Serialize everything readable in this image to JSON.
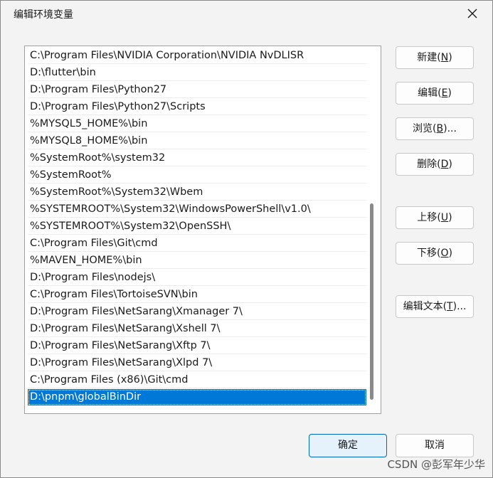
{
  "dialog": {
    "title": "编辑环境变量"
  },
  "paths": [
    "C:\\Program Files\\NVIDIA Corporation\\NVIDIA NvDLISR",
    "D:\\flutter\\bin",
    "D:\\Program Files\\Python27",
    "D:\\Program Files\\Python27\\Scripts",
    "%MYSQL5_HOME%\\bin",
    "%MYSQL8_HOME%\\bin",
    "%SystemRoot%\\system32",
    "%SystemRoot%",
    "%SystemRoot%\\System32\\Wbem",
    "%SYSTEMROOT%\\System32\\WindowsPowerShell\\v1.0\\",
    "%SYSTEMROOT%\\System32\\OpenSSH\\",
    "C:\\Program Files\\Git\\cmd",
    "%MAVEN_HOME%\\bin",
    "D:\\Program Files\\nodejs\\",
    "C:\\Program Files\\TortoiseSVN\\bin",
    "D:\\Program Files\\NetSarang\\Xmanager 7\\",
    "D:\\Program Files\\NetSarang\\Xshell 7\\",
    "D:\\Program Files\\NetSarang\\Xftp 7\\",
    "D:\\Program Files\\NetSarang\\Xlpd 7\\",
    "C:\\Program Files (x86)\\Git\\cmd",
    "D:\\pnpm\\globalBinDir"
  ],
  "selected_index": 20,
  "buttons": {
    "new": {
      "text": "新建(",
      "key": "N",
      "end": ")"
    },
    "edit": {
      "text": "编辑(",
      "key": "E",
      "end": ")"
    },
    "browse": {
      "text": "浏览(",
      "key": "B",
      "end": ")..."
    },
    "delete": {
      "text": "删除(",
      "key": "D",
      "end": ")"
    },
    "move_up": {
      "text": "上移(",
      "key": "U",
      "end": ")"
    },
    "move_down": {
      "text": "下移(",
      "key": "O",
      "end": ")"
    },
    "edit_text": {
      "text": "编辑文本(",
      "key": "T",
      "end": ")..."
    }
  },
  "footer": {
    "ok": "确定",
    "cancel": "取消"
  },
  "watermark": "CSDN @彭军年少华",
  "colors": {
    "selection": "#0078d7",
    "primary_border": "#0067c0"
  }
}
